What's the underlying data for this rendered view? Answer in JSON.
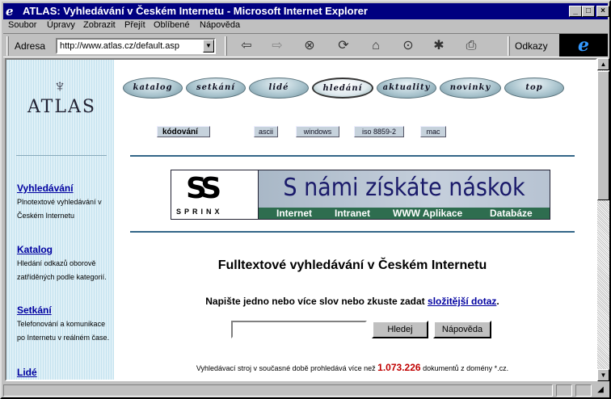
{
  "window": {
    "title": "ATLAS: Vyhledávání v Českém Internetu - Microsoft Internet Explorer",
    "controls": {
      "minimize": "_",
      "maximize": "□",
      "close": "×"
    }
  },
  "menu": [
    "Soubor",
    "Úpravy",
    "Zobrazit",
    "Přejít",
    "Oblíbené",
    "Nápověda"
  ],
  "toolbar": {
    "address_label": "Adresa",
    "address_value": "http://www.atlas.cz/default.asp",
    "links_label": "Odkazy",
    "icons": [
      "back-icon",
      "forward-icon",
      "stop-icon",
      "refresh-icon",
      "home-icon",
      "search-icon",
      "favorites-icon",
      "print-icon"
    ]
  },
  "sidebar": {
    "logo_text": "ATLAS",
    "items": [
      {
        "label": "Vyhledávání",
        "desc": "Plnotextové vyhledávání v Českém Internetu"
      },
      {
        "label": "Katalog",
        "desc": "Hledání odkazů oborově zatříděných podle kategorií."
      },
      {
        "label": "Setkání",
        "desc": "Telefonování a komunikace po Internetu v reálném čase."
      },
      {
        "label": "Lidé",
        "desc": ""
      }
    ]
  },
  "nav": {
    "buttons": [
      "katalog",
      "setkání",
      "lidé",
      "hledání",
      "aktuality",
      "novinky",
      "top"
    ],
    "active": "hledání"
  },
  "encoding": {
    "label": "kódování",
    "options": [
      "ascii",
      "windows",
      "iso 8859-2",
      "mac"
    ]
  },
  "banner": {
    "brand": "SPRINX",
    "slogan": "S námi získáte náskok",
    "bar_items": [
      "Internet",
      "Intranet",
      "WWW Aplikace",
      "Databáze"
    ]
  },
  "main": {
    "title": "Fulltextové vyhledávání v Českém Internetu",
    "instruction": "Napište jedno nebo více slov nebo zkuste zadat",
    "instruction_link": "složitější dotaz",
    "instruction_end": ".",
    "search_value": "",
    "search_button": "Hledej",
    "help_button": "Nápověda",
    "stats_prefix": "Vyhledávací stroj v současné době prohledává více než",
    "stats_count": "1.073.226",
    "stats_suffix": "dokumentů z domény *.cz."
  },
  "colors": {
    "titlebar": "#000080",
    "link": "#0000a0",
    "accent_red": "#c00000",
    "banner_bar": "#2e6d4f"
  }
}
